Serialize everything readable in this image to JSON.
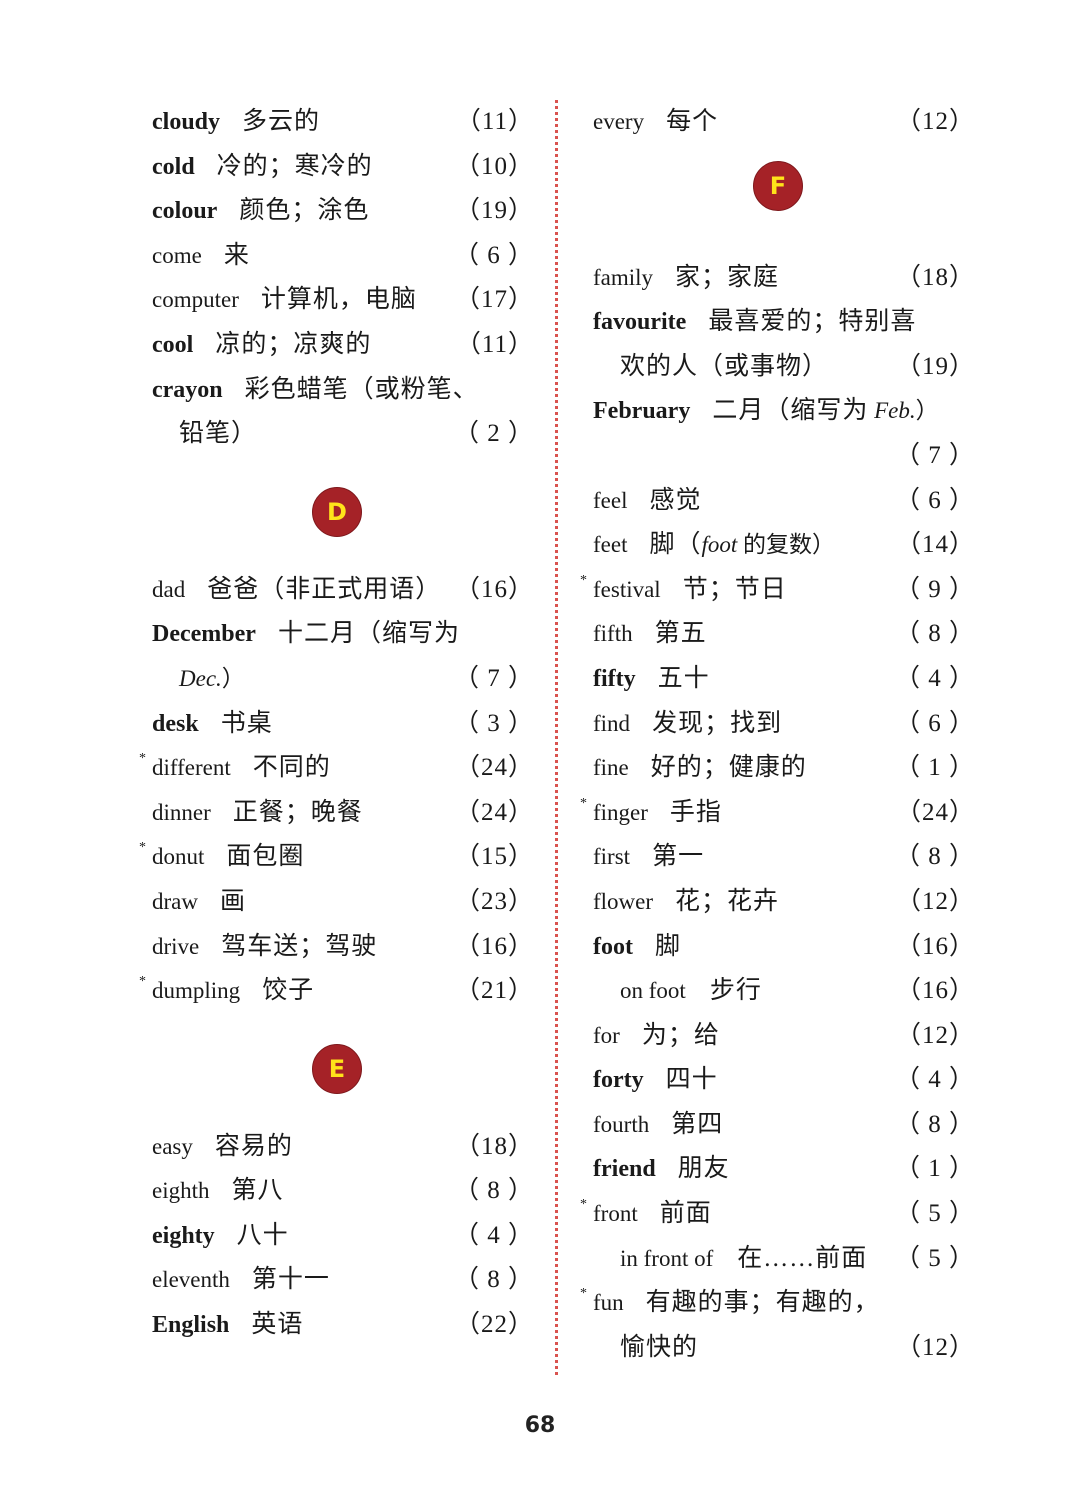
{
  "left_column": {
    "group1": [
      {
        "word": "cloudy",
        "bold": true,
        "star": false,
        "meaning": "多云的",
        "page": "（11）"
      },
      {
        "word": "cold",
        "bold": true,
        "star": false,
        "meaning": "冷的；寒冷的",
        "page": "（10）"
      },
      {
        "word": "colour",
        "bold": true,
        "star": false,
        "meaning": "颜色；涂色",
        "page": "（19）"
      },
      {
        "word": "come",
        "bold": false,
        "star": false,
        "meaning": "来",
        "page": "（ 6 ）"
      },
      {
        "word": "computer",
        "bold": false,
        "star": false,
        "meaning": "计算机，电脑",
        "page": "（17）"
      },
      {
        "word": "cool",
        "bold": true,
        "star": false,
        "meaning": "凉的；凉爽的",
        "page": "（11）"
      },
      {
        "word": "crayon",
        "bold": true,
        "star": false,
        "meaning": "彩色蜡笔（或粉笔、",
        "meaning_cont": "铅笔）",
        "page": "（ 2 ）"
      }
    ],
    "badge_d": "D",
    "group_d": [
      {
        "word": "dad",
        "bold": false,
        "star": false,
        "meaning": "爸爸（非正式用语）",
        "page": "（16）"
      },
      {
        "word": "December",
        "bold": true,
        "star": false,
        "meaning": "十二月（缩写为",
        "meaning_cont_italic": "Dec.",
        "meaning_cont": "）",
        "page": "（ 7 ）"
      },
      {
        "word": "desk",
        "bold": true,
        "star": false,
        "meaning": "书桌",
        "page": "（ 3 ）"
      },
      {
        "word": "different",
        "bold": false,
        "star": true,
        "meaning": "不同的",
        "page": "（24）"
      },
      {
        "word": "dinner",
        "bold": false,
        "star": false,
        "meaning": "正餐；晚餐",
        "page": "（24）"
      },
      {
        "word": "donut",
        "bold": false,
        "star": true,
        "meaning": "面包圈",
        "page": "（15）"
      },
      {
        "word": "draw",
        "bold": false,
        "star": false,
        "meaning": "画",
        "page": "（23）"
      },
      {
        "word": "drive",
        "bold": false,
        "star": false,
        "meaning": "驾车送；驾驶",
        "page": "（16）"
      },
      {
        "word": "dumpling",
        "bold": false,
        "star": true,
        "meaning": "饺子",
        "page": "（21）"
      }
    ],
    "badge_e": "E",
    "group_e": [
      {
        "word": "easy",
        "bold": false,
        "star": false,
        "meaning": "容易的",
        "page": "（18）"
      },
      {
        "word": "eighth",
        "bold": false,
        "star": false,
        "meaning": "第八",
        "page": "（ 8 ）"
      },
      {
        "word": "eighty",
        "bold": true,
        "star": false,
        "meaning": "八十",
        "page": "（ 4 ）"
      },
      {
        "word": "eleventh",
        "bold": false,
        "star": false,
        "meaning": "第十一",
        "page": "（ 8 ）"
      },
      {
        "word": "English",
        "bold": true,
        "star": false,
        "meaning": "英语",
        "page": "（22）"
      }
    ]
  },
  "right_column": {
    "group_e_tail": [
      {
        "word": "every",
        "bold": false,
        "star": false,
        "meaning": "每个",
        "page": "（12）"
      }
    ],
    "badge_f": "F",
    "group_f": [
      {
        "word": "family",
        "bold": false,
        "star": false,
        "meaning": "家；家庭",
        "page": "（18）"
      },
      {
        "word": "favourite",
        "bold": true,
        "star": false,
        "meaning": "最喜爱的；特别喜",
        "meaning_cont": "欢的人（或事物）",
        "page": "（19）"
      },
      {
        "word": "February",
        "bold": true,
        "star": false,
        "meaning": "二月（缩写为",
        "meaning_italic": "Feb.",
        "meaning_tail": "）",
        "page": "（ 7 ）"
      },
      {
        "word": "feel",
        "bold": false,
        "star": false,
        "meaning": "感觉",
        "page": "（ 6 ）"
      },
      {
        "word": "feet",
        "bold": false,
        "star": false,
        "meaning": "脚（",
        "meaning_italic": "foot",
        "meaning_tail": " 的复数）",
        "page": "（14）"
      },
      {
        "word": "festival",
        "bold": false,
        "star": true,
        "meaning": "节；节日",
        "page": "（ 9 ）"
      },
      {
        "word": "fifth",
        "bold": false,
        "star": false,
        "meaning": "第五",
        "page": "（ 8 ）"
      },
      {
        "word": "fifty",
        "bold": true,
        "star": false,
        "meaning": "五十",
        "page": "（ 4 ）"
      },
      {
        "word": "find",
        "bold": false,
        "star": false,
        "meaning": "发现；找到",
        "page": "（ 6 ）"
      },
      {
        "word": "fine",
        "bold": false,
        "star": false,
        "meaning": "好的；健康的",
        "page": "（ 1 ）"
      },
      {
        "word": "finger",
        "bold": false,
        "star": true,
        "meaning": "手指",
        "page": "（24）"
      },
      {
        "word": "first",
        "bold": false,
        "star": false,
        "meaning": "第一",
        "page": "（ 8 ）"
      },
      {
        "word": "flower",
        "bold": false,
        "star": false,
        "meaning": "花；花卉",
        "page": "（12）"
      },
      {
        "word": "foot",
        "bold": true,
        "star": false,
        "meaning": "脚",
        "page": "（16）"
      },
      {
        "word": "on foot",
        "bold": false,
        "star": false,
        "sub": true,
        "meaning": "步行",
        "page": "（16）"
      },
      {
        "word": "for",
        "bold": false,
        "star": false,
        "meaning": "为；给",
        "page": "（12）"
      },
      {
        "word": "forty",
        "bold": true,
        "star": false,
        "meaning": "四十",
        "page": "（ 4 ）"
      },
      {
        "word": "fourth",
        "bold": false,
        "star": false,
        "meaning": "第四",
        "page": "（ 8 ）"
      },
      {
        "word": "friend",
        "bold": true,
        "star": false,
        "meaning": "朋友",
        "page": "（ 1 ）"
      },
      {
        "word": "front",
        "bold": false,
        "star": true,
        "meaning": "前面",
        "page": "（ 5 ）"
      },
      {
        "word": "in front of",
        "bold": false,
        "star": false,
        "sub": true,
        "meaning": "在……前面",
        "page": "（ 5 ）"
      },
      {
        "word": "fun",
        "bold": false,
        "star": true,
        "meaning": "有趣的事；有趣的，",
        "meaning_cont": "愉快的",
        "page": "（12）"
      }
    ]
  },
  "star_mark": "*",
  "page_number": "68",
  "colors": {
    "badge_fill": "#a52227",
    "badge_letter": "#ffe31a",
    "divider": "#d9534f",
    "text": "#1a1a1a"
  }
}
